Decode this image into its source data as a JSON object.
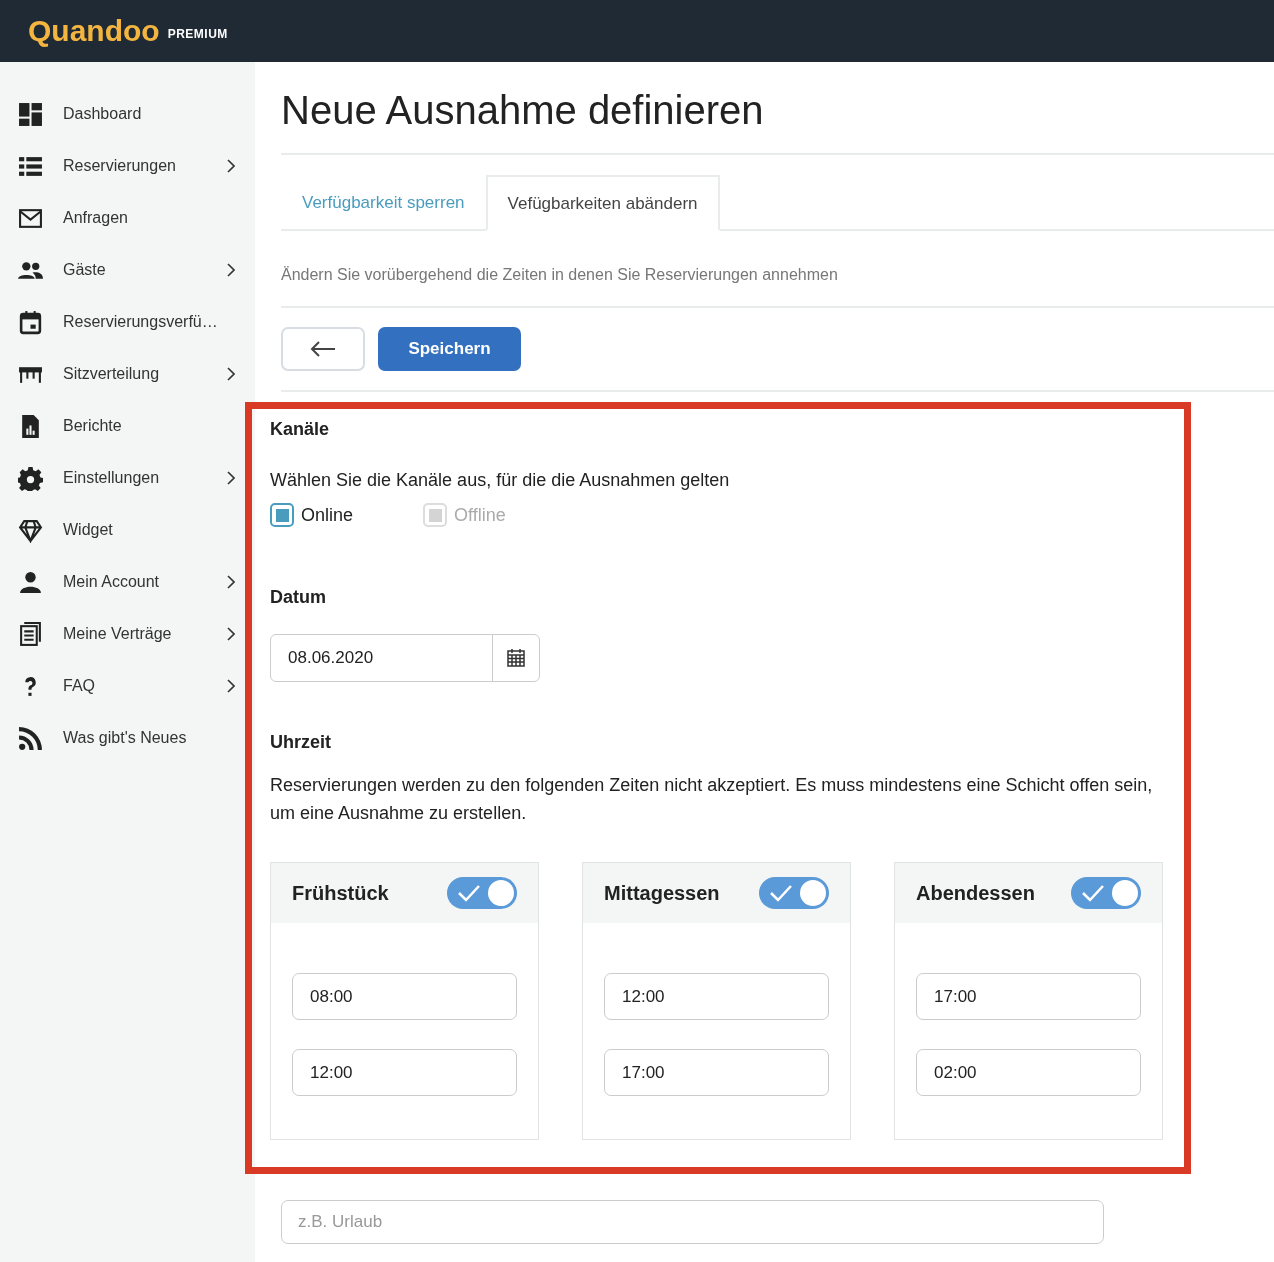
{
  "header": {
    "logo": "Quandoo",
    "badge": "PREMIUM"
  },
  "sidebar": {
    "items": [
      {
        "label": "Dashboard",
        "expandable": false
      },
      {
        "label": "Reservierungen",
        "expandable": true
      },
      {
        "label": "Anfragen",
        "expandable": false
      },
      {
        "label": "Gäste",
        "expandable": true
      },
      {
        "label": "Reservierungsverfü…",
        "expandable": false
      },
      {
        "label": "Sitzverteilung",
        "expandable": true
      },
      {
        "label": "Berichte",
        "expandable": false
      },
      {
        "label": "Einstellungen",
        "expandable": true
      },
      {
        "label": "Widget",
        "expandable": false
      },
      {
        "label": "Mein Account",
        "expandable": true
      },
      {
        "label": "Meine Verträge",
        "expandable": true
      },
      {
        "label": "FAQ",
        "expandable": true
      },
      {
        "label": "Was gibt's Neues",
        "expandable": false
      }
    ]
  },
  "page": {
    "title": "Neue Ausnahme definieren",
    "tabs": [
      {
        "label": "Verfügbarkeit sperren",
        "selected": false
      },
      {
        "label": "Vefügbarkeiten abändern",
        "selected": true
      }
    ],
    "description": "Ändern Sie vorübergehend die Zeiten in denen Sie Reservierungen annehmen",
    "save_button": "Speichern",
    "channels": {
      "heading": "Kanäle",
      "hint": "Wählen Sie die Kanäle aus, für die die Ausnahmen gelten",
      "options": [
        {
          "label": "Online",
          "checked": true,
          "disabled": false
        },
        {
          "label": "Offline",
          "checked": true,
          "disabled": true
        }
      ]
    },
    "date": {
      "heading": "Datum",
      "value": "08.06.2020"
    },
    "time": {
      "heading": "Uhrzeit",
      "hint": "Reservierungen werden zu den folgenden Zeiten nicht akzeptiert. Es muss mindestens eine Schicht offen sein, um eine Ausnahme zu erstellen.",
      "shifts": [
        {
          "name": "Frühstück",
          "on": true,
          "from": "08:00",
          "to": "12:00"
        },
        {
          "name": "Mittagessen",
          "on": true,
          "from": "12:00",
          "to": "17:00"
        },
        {
          "name": "Abendessen",
          "on": true,
          "from": "17:00",
          "to": "02:00"
        }
      ]
    },
    "note": {
      "placeholder": "z.B. Urlaub"
    }
  }
}
